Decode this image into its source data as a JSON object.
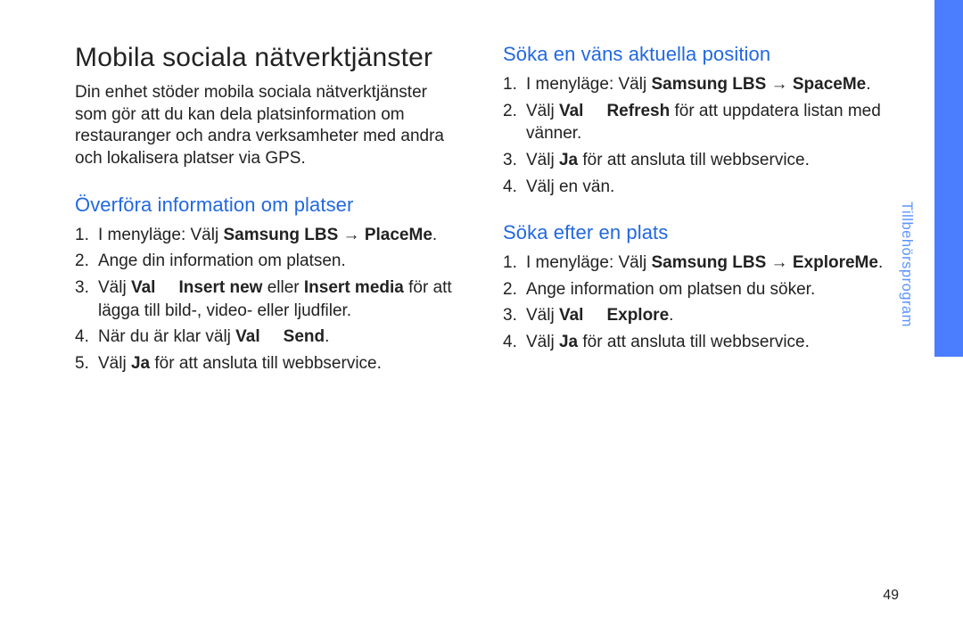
{
  "title": "Mobila sociala nätverktjänster",
  "intro": "Din enhet stöder mobila sociala nätverktjänster som gör att du kan dela platsinformation om restauranger och andra verksamheter med andra och lokalisera platser via GPS.",
  "section1": {
    "heading": "Överföra information om platser",
    "items": [
      {
        "pre": "I menyläge: Välj ",
        "b1": "Samsung LBS",
        "mid": " → ",
        "b2": "PlaceMe",
        "post": "."
      },
      {
        "text": "Ange din information om platsen."
      },
      {
        "pre": "Välj ",
        "b1": "Val",
        "mid": " → ",
        "b2": "Insert new",
        "mid2": " eller ",
        "b3": "Insert media",
        "post": " för att lägga till bild-, video- eller ljudfiler."
      },
      {
        "pre": "När du är klar välj ",
        "b1": "Val",
        "mid": " → ",
        "b2": "Send",
        "post": "."
      },
      {
        "pre": "Välj ",
        "b1": "Ja",
        "post": " för att ansluta till webbservice."
      }
    ]
  },
  "section2": {
    "heading": "Söka en väns aktuella position",
    "items": [
      {
        "pre": "I menyläge: Välj ",
        "b1": "Samsung LBS",
        "mid": " → ",
        "b2": "SpaceMe",
        "post": "."
      },
      {
        "pre": "Välj ",
        "b1": "Val",
        "mid": " → ",
        "b2": "Refresh",
        "post": " för att uppdatera listan med vänner."
      },
      {
        "pre": "Välj ",
        "b1": "Ja",
        "post": " för att ansluta till webbservice."
      },
      {
        "text": "Välj en vän."
      }
    ]
  },
  "section3": {
    "heading": "Söka efter en plats",
    "items": [
      {
        "pre": "I menyläge: Välj ",
        "b1": "Samsung LBS",
        "mid": " → ",
        "b2": "ExploreMe",
        "post": "."
      },
      {
        "text": "Ange information om platsen du söker."
      },
      {
        "pre": "Välj ",
        "b1": "Val",
        "mid": " → ",
        "b2": "Explore",
        "post": "."
      },
      {
        "pre": "Välj ",
        "b1": "Ja",
        "post": " för att ansluta till webbservice."
      }
    ]
  },
  "side_label": "Tillbehörsprogram",
  "page_number": "49"
}
